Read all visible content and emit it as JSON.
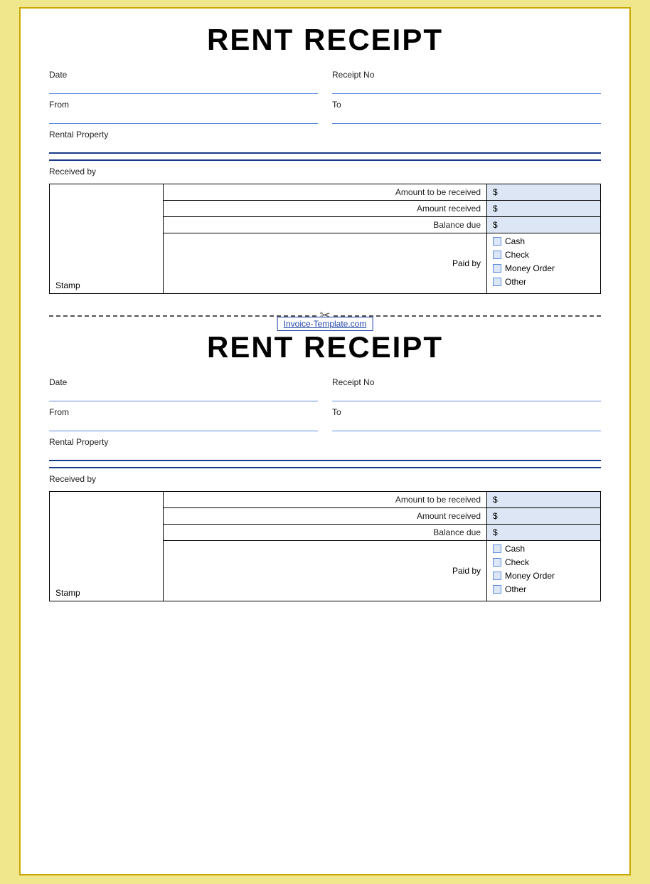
{
  "receipt1": {
    "title": "RENT RECEIPT",
    "date_label": "Date",
    "receipt_no_label": "Receipt No",
    "from_label": "From",
    "to_label": "To",
    "rental_property_label": "Rental Property",
    "received_by_label": "Received by",
    "amount_to_be_received_label": "Amount to be received",
    "amount_received_label": "Amount received",
    "balance_due_label": "Balance due",
    "paid_by_label": "Paid by",
    "dollar_sign1": "$",
    "dollar_sign2": "$",
    "dollar_sign3": "$",
    "stamp_label": "Stamp",
    "cash_label": "Cash",
    "check_label": "Check",
    "money_order_label": "Money Order",
    "other_label": "Other"
  },
  "receipt2": {
    "title": "RENT RECEIPT",
    "date_label": "Date",
    "receipt_no_label": "Receipt No",
    "from_label": "From",
    "to_label": "To",
    "rental_property_label": "Rental Property",
    "received_by_label": "Received by",
    "amount_to_be_received_label": "Amount to be received",
    "amount_received_label": "Amount received",
    "balance_due_label": "Balance due",
    "paid_by_label": "Paid by",
    "dollar_sign1": "$",
    "dollar_sign2": "$",
    "dollar_sign3": "$",
    "stamp_label": "Stamp",
    "cash_label": "Cash",
    "check_label": "Check",
    "money_order_label": "Money Order",
    "other_label": "Other"
  },
  "watermark": {
    "text": "Invoice-Template.com"
  }
}
